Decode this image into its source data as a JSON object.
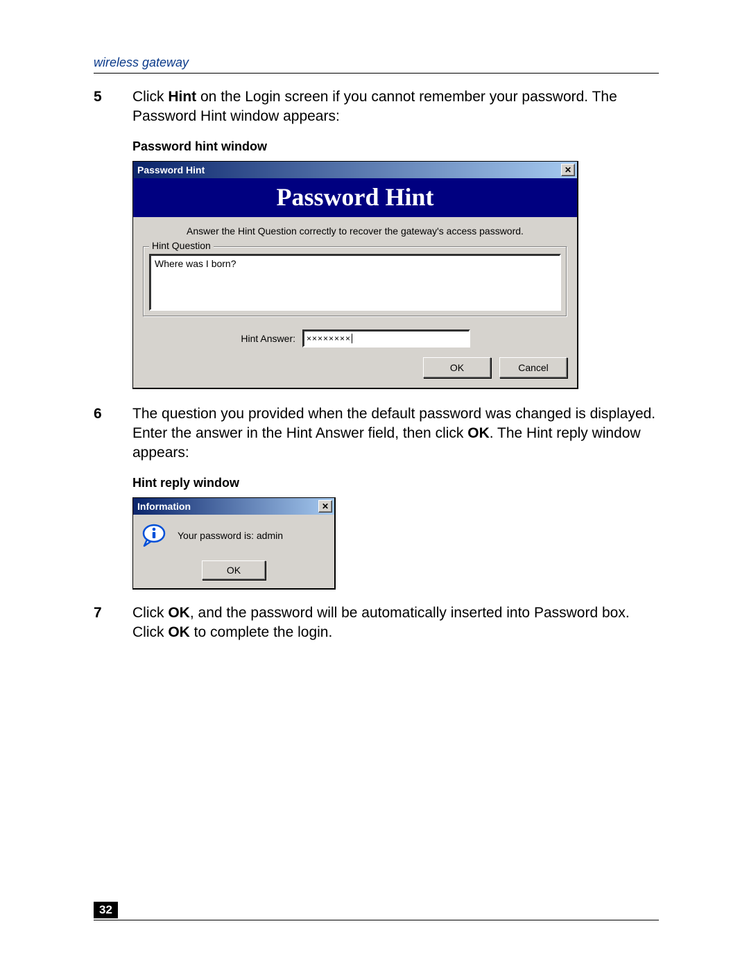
{
  "header": {
    "section": "wireless gateway"
  },
  "steps": {
    "s5": {
      "num": "5",
      "pre": "Click ",
      "b1": "Hint",
      "post": " on the Login screen if you cannot remember your password. The Password Hint window appears:"
    },
    "s6": {
      "num": "6",
      "pre": "The question you provided when the default password was changed is displayed. Enter the answer in the Hint Answer field, then click ",
      "b1": "OK",
      "post": ". The Hint reply window appears:"
    },
    "s7": {
      "num": "7",
      "pre": "Click ",
      "b1": "OK",
      "mid": ", and the password will be automatically inserted into Password box. Click ",
      "b2": "OK",
      "post": " to complete the login."
    }
  },
  "captions": {
    "hint_window": "Password hint window",
    "reply_window": "Hint reply window"
  },
  "hint_window": {
    "titlebar": "Password Hint",
    "banner": "Password Hint",
    "instruction": "Answer the Hint Question correctly to recover the gateway's access password.",
    "group_legend": "Hint Question",
    "question_text": "Where was I born?",
    "answer_label": "Hint Answer:",
    "answer_value": "××××××××",
    "ok": "OK",
    "cancel": "Cancel"
  },
  "info_window": {
    "titlebar": "Information",
    "message": "Your password is: admin",
    "ok": "OK"
  },
  "footer": {
    "page_number": "32"
  }
}
